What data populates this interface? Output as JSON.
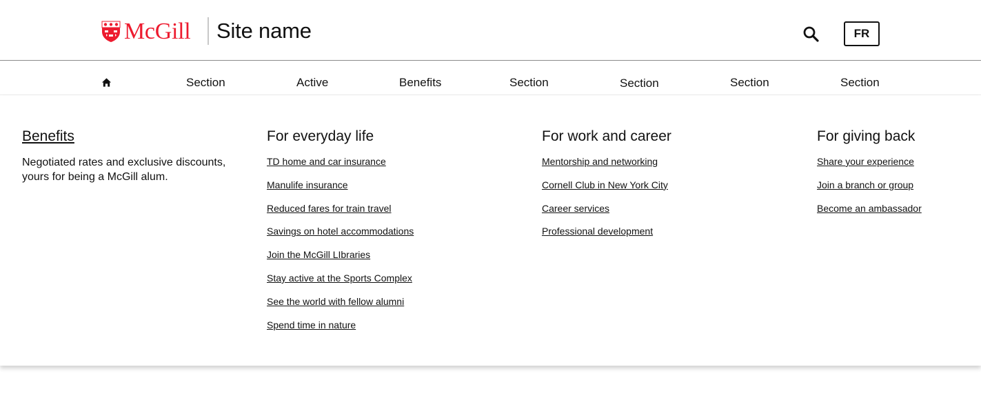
{
  "header": {
    "logo_text": "McGill",
    "site_name": "Site name",
    "lang_button": "FR",
    "brand_color": "#ed1b2f"
  },
  "nav": {
    "items": [
      {
        "label": "Section"
      },
      {
        "label": "Active"
      },
      {
        "label": "Benefits",
        "active": true
      },
      {
        "label": "Section"
      },
      {
        "label": "Section"
      },
      {
        "label": "Section"
      },
      {
        "label": "Section"
      }
    ]
  },
  "mega_menu": {
    "intro": {
      "title": "Benefits",
      "text": "Negotiated rates and exclusive discounts, yours for being a McGill alum."
    },
    "columns": [
      {
        "title": "For everyday life",
        "links": [
          "TD home and car insurance",
          "Manulife insurance",
          "Reduced fares for train travel",
          "Savings on hotel accommodations",
          "Join the McGill LIbraries",
          "Stay active at the Sports Complex",
          "See the world with fellow alumni",
          "Spend time in nature"
        ]
      },
      {
        "title": "For work and career",
        "links": [
          "Mentorship and networking",
          "Cornell Club in New York City",
          "Career services",
          "Professional development"
        ]
      },
      {
        "title": "For giving back",
        "links": [
          "Share your experience",
          "Join a branch or group",
          "Become an ambassador"
        ]
      }
    ]
  }
}
